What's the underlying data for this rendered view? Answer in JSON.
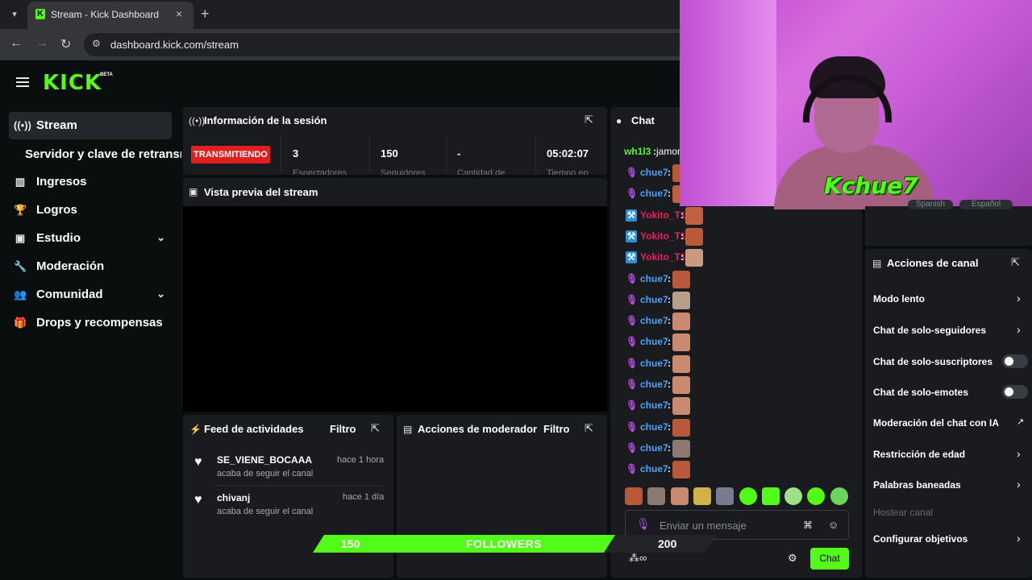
{
  "browser": {
    "tab_title": "Stream - Kick Dashboard",
    "tab_close": "×",
    "new_tab": "+",
    "url": "dashboard.kick.com/stream"
  },
  "brand": {
    "logo": "KICK",
    "badge": "BETA",
    "accent": "#53fc18"
  },
  "sidebar": {
    "items": [
      {
        "label": "Stream",
        "icon": "broadcast-icon"
      },
      {
        "label": "Servidor y clave de retransmisión",
        "icon": ""
      },
      {
        "label": "Ingresos",
        "icon": "chart-icon"
      },
      {
        "label": "Logros",
        "icon": "trophy-icon"
      },
      {
        "label": "Estudio",
        "icon": "studio-icon"
      },
      {
        "label": "Moderación",
        "icon": "wrench-icon"
      },
      {
        "label": "Comunidad",
        "icon": "community-icon"
      },
      {
        "label": "Drops y recompensas",
        "icon": "gift-icon"
      }
    ]
  },
  "session": {
    "title": "Información de la sesión",
    "status": "TRANSMITIENDO",
    "status_color": "#e01f1f",
    "stats": [
      {
        "value": "3",
        "label": "Espectadores"
      },
      {
        "value": "150",
        "label": "Seguidores"
      },
      {
        "value": "-",
        "label": "Cantidad de"
      },
      {
        "value": "05:02:07",
        "label": "Tiempo en"
      }
    ]
  },
  "preview": {
    "title": "Vista previa del stream"
  },
  "feed": {
    "title": "Feed de actividades",
    "filter": "Filtro",
    "items": [
      {
        "user": "SE_VIENE_BOCAAA",
        "time": "hace 1 hora",
        "desc": "acaba de seguir el canal"
      },
      {
        "user": "chivanj",
        "time": "hace 1 día",
        "desc": "acaba de seguir el canal"
      }
    ]
  },
  "mod_actions": {
    "title": "Acciones de moderador",
    "filter": "Filtro"
  },
  "chat": {
    "title": "Chat",
    "messages": [
      {
        "user": "wh1l3",
        "text": "jamon",
        "color": "#53fc18",
        "badge": ""
      },
      {
        "user": "chue7",
        "color": "#4aa3ff",
        "badge": "mic"
      },
      {
        "user": "chue7",
        "color": "#4aa3ff",
        "badge": "mic"
      },
      {
        "user": "Yokito_T1",
        "color": "#e0245e",
        "badge": "mod"
      },
      {
        "user": "Yokito_T1",
        "color": "#e0245e",
        "badge": "mod"
      },
      {
        "user": "Yokito_T1",
        "color": "#e0245e",
        "badge": "mod"
      },
      {
        "user": "chue7",
        "color": "#4aa3ff",
        "badge": "mic"
      },
      {
        "user": "chue7",
        "color": "#4aa3ff",
        "badge": "mic"
      },
      {
        "user": "chue7",
        "color": "#4aa3ff",
        "badge": "mic"
      },
      {
        "user": "chue7",
        "color": "#4aa3ff",
        "badge": "mic"
      },
      {
        "user": "chue7",
        "color": "#4aa3ff",
        "badge": "mic"
      },
      {
        "user": "chue7",
        "color": "#4aa3ff",
        "badge": "mic"
      },
      {
        "user": "chue7",
        "color": "#4aa3ff",
        "badge": "mic"
      },
      {
        "user": "chue7",
        "color": "#4aa3ff",
        "badge": "mic"
      },
      {
        "user": "chue7",
        "color": "#4aa3ff",
        "badge": "mic"
      },
      {
        "user": "chue7",
        "color": "#4aa3ff",
        "badge": "mic"
      }
    ],
    "input_placeholder": "Enviar un mensaje",
    "send_label": "Chat"
  },
  "webcam": {
    "overlay_name": "Kchue7",
    "chip_left": "Spanish",
    "chip_right": "Español"
  },
  "channel_actions": {
    "title": "Acciones de canal",
    "items": [
      {
        "label": "Modo lento",
        "control": "chevron"
      },
      {
        "label": "Chat de solo-seguidores",
        "control": "chevron"
      },
      {
        "label": "Chat de solo-suscriptores",
        "control": "toggle",
        "on": false
      },
      {
        "label": "Chat de solo-emotes",
        "control": "toggle",
        "on": false
      },
      {
        "label": "Moderación del chat con IA",
        "control": "external"
      },
      {
        "label": "Restricción de edad",
        "control": "chevron"
      },
      {
        "label": "Palabras baneadas",
        "control": "chevron"
      },
      {
        "label": "Hostear canal",
        "control": "disabled"
      },
      {
        "label": "Configurar objetivos",
        "control": "chevron"
      }
    ]
  },
  "follower_goal": {
    "current": "150",
    "label": "FOLLOWERS",
    "target": "200",
    "progress": 0.75
  }
}
